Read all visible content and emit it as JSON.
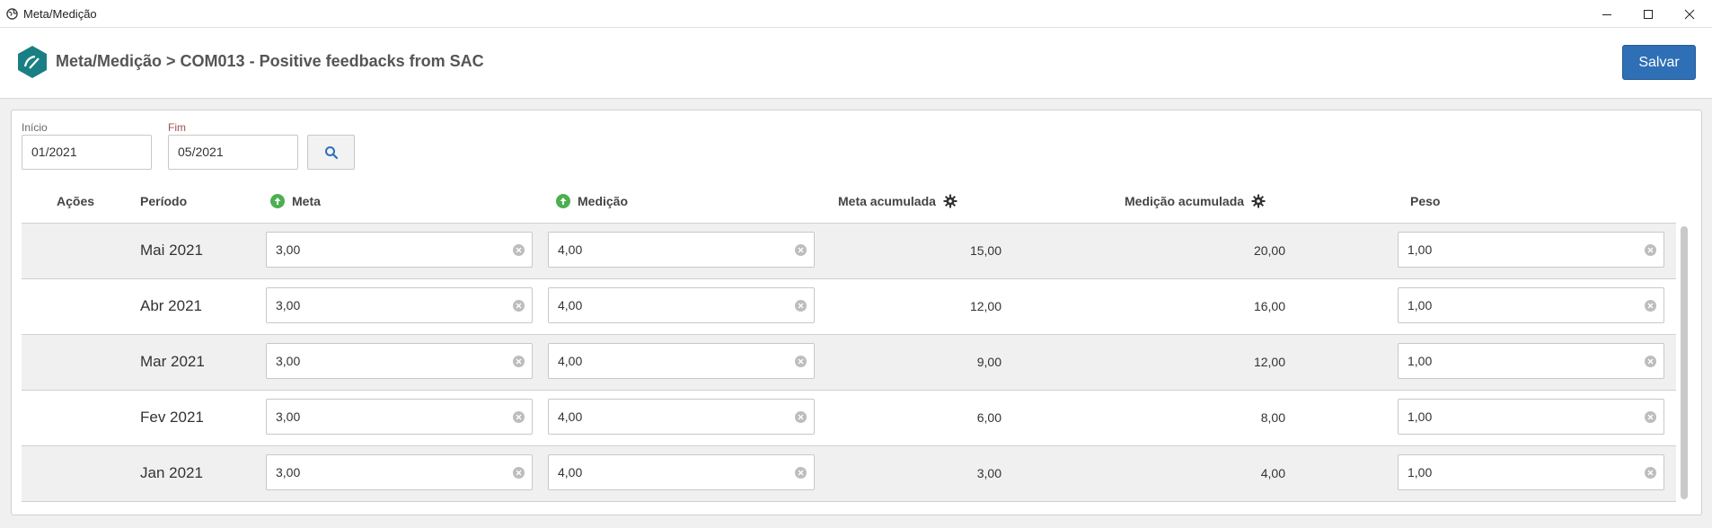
{
  "window": {
    "title": "Meta/Medição"
  },
  "header": {
    "breadcrumb": "Meta/Medição > COM013 - Positive feedbacks from SAC",
    "save_label": "Salvar"
  },
  "filters": {
    "inicio_label": "Início",
    "inicio_value": "01/2021",
    "fim_label": "Fim",
    "fim_value": "05/2021"
  },
  "table": {
    "columns": {
      "acoes": "Ações",
      "periodo": "Período",
      "meta": "Meta",
      "medicao": "Medição",
      "meta_acumulada": "Meta acumulada",
      "medicao_acumulada": "Medição acumulada",
      "peso": "Peso"
    },
    "rows": [
      {
        "periodo": "Mai 2021",
        "meta": "3,00",
        "medicao": "4,00",
        "meta_acumulada": "15,00",
        "medicao_acumulada": "20,00",
        "peso": "1,00"
      },
      {
        "periodo": "Abr 2021",
        "meta": "3,00",
        "medicao": "4,00",
        "meta_acumulada": "12,00",
        "medicao_acumulada": "16,00",
        "peso": "1,00"
      },
      {
        "periodo": "Mar 2021",
        "meta": "3,00",
        "medicao": "4,00",
        "meta_acumulada": "9,00",
        "medicao_acumulada": "12,00",
        "peso": "1,00"
      },
      {
        "periodo": "Fev 2021",
        "meta": "3,00",
        "medicao": "4,00",
        "meta_acumulada": "6,00",
        "medicao_acumulada": "8,00",
        "peso": "1,00"
      },
      {
        "periodo": "Jan 2021",
        "meta": "3,00",
        "medicao": "4,00",
        "meta_acumulada": "3,00",
        "medicao_acumulada": "4,00",
        "peso": "1,00"
      }
    ]
  },
  "colors": {
    "accent": "#2e6fb5",
    "logo": "#1a7f84",
    "trend_up": "#4caf50"
  },
  "icons": {
    "app": "globe-icon",
    "logo": "hexagon-gauge-icon",
    "search": "search-icon",
    "trend": "arrow-up-circle-icon",
    "settings": "gear-icon",
    "clear": "clear-icon"
  }
}
